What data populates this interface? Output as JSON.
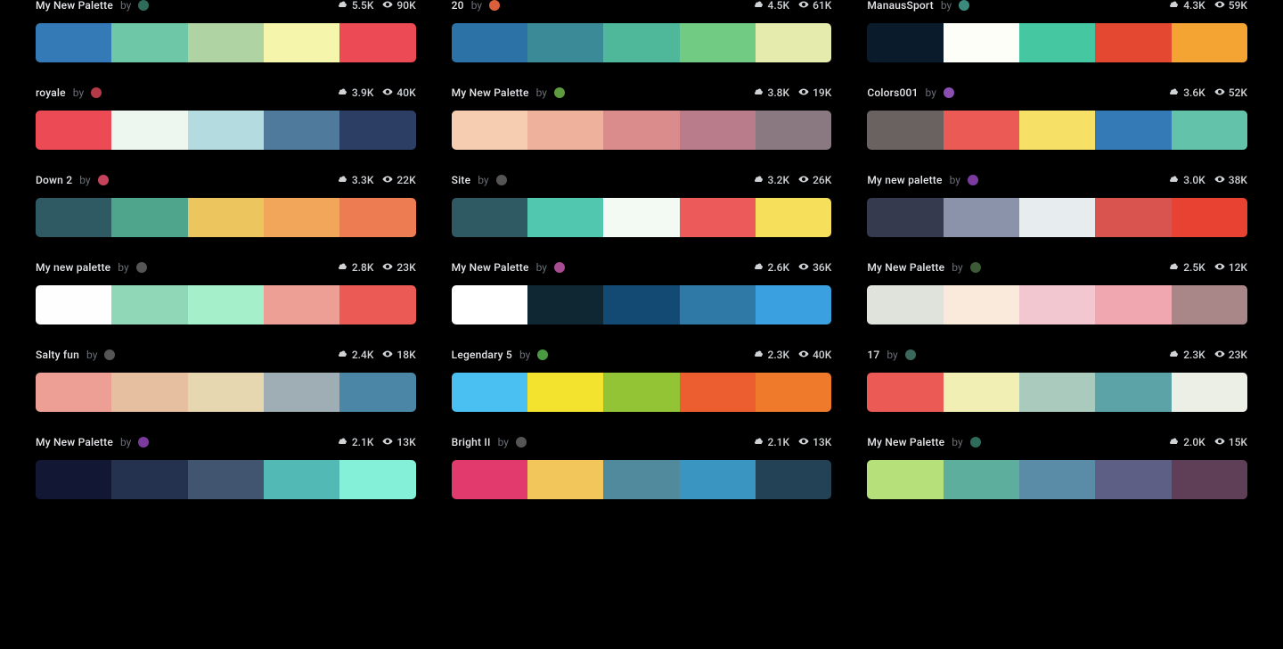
{
  "labels": {
    "by": "by"
  },
  "palettes": [
    {
      "title": "My New Palette",
      "avatar": "#2f6b5a",
      "downloads": "5.5K",
      "views": "90K",
      "colors": [
        "#337ab7",
        "#6ec7a6",
        "#b0d3a3",
        "#f6f5ac",
        "#ec4a55"
      ]
    },
    {
      "title": "20",
      "avatar": "#d9603b",
      "downloads": "4.5K",
      "views": "61K",
      "colors": [
        "#2d72a6",
        "#3b8a98",
        "#4fb79a",
        "#72cb82",
        "#e5ebad"
      ]
    },
    {
      "title": "ManausSport",
      "avatar": "#3c8a7d",
      "downloads": "4.3K",
      "views": "59K",
      "colors": [
        "#0a1b2b",
        "#fcfef7",
        "#45c7a1",
        "#e44830",
        "#f3a432"
      ]
    },
    {
      "title": "royale",
      "avatar": "#b33a46",
      "downloads": "3.9K",
      "views": "40K",
      "colors": [
        "#ec4a55",
        "#edf7ef",
        "#b3dbe0",
        "#507a9c",
        "#2c3e63"
      ]
    },
    {
      "title": "My New Palette",
      "avatar": "#5e9b3e",
      "downloads": "3.8K",
      "views": "19K",
      "colors": [
        "#f6cdb0",
        "#eeb19c",
        "#d98c8b",
        "#b87c8a",
        "#8b7982"
      ]
    },
    {
      "title": "Colors001",
      "avatar": "#8a4fb0",
      "downloads": "3.6K",
      "views": "52K",
      "colors": [
        "#6a6260",
        "#ec5a55",
        "#f6e065",
        "#337ab7",
        "#63c2aa"
      ]
    },
    {
      "title": "Down 2",
      "avatar": "#c4435a",
      "downloads": "3.3K",
      "views": "22K",
      "colors": [
        "#2f5a63",
        "#4ea58c",
        "#ecc55f",
        "#f2a65a",
        "#ed7c53"
      ]
    },
    {
      "title": "Site",
      "avatar": "#555",
      "downloads": "3.2K",
      "views": "26K",
      "colors": [
        "#2f5a63",
        "#51c7b0",
        "#f2faf3",
        "#ec5a5a",
        "#f6df5a"
      ]
    },
    {
      "title": "My new palette",
      "avatar": "#7a3a9e",
      "downloads": "3.0K",
      "views": "38K",
      "colors": [
        "#363a4f",
        "#8b93ab",
        "#e7ecef",
        "#d9534f",
        "#e84332"
      ]
    },
    {
      "title": "My new palette",
      "avatar": "#555",
      "downloads": "2.8K",
      "views": "23K",
      "colors": [
        "#fdfefd",
        "#8fd7b7",
        "#a5f0ca",
        "#ee9f95",
        "#ec5a55"
      ]
    },
    {
      "title": "My New Palette",
      "avatar": "#a74c90",
      "downloads": "2.6K",
      "views": "36K",
      "colors": [
        "#ffffff",
        "#0f2733",
        "#134a73",
        "#2e79a6",
        "#3aa0e0"
      ]
    },
    {
      "title": "My New Palette",
      "avatar": "#3c5a36",
      "downloads": "2.5K",
      "views": "12K",
      "colors": [
        "#e0e3dc",
        "#f9eadb",
        "#f3c7cf",
        "#f0a7b0",
        "#a98788"
      ]
    },
    {
      "title": "Salty fun",
      "avatar": "#555",
      "downloads": "2.4K",
      "views": "18K",
      "colors": [
        "#ee9f95",
        "#e5bfa0",
        "#e7d7b0",
        "#9eaeb4",
        "#4b86a6"
      ]
    },
    {
      "title": "Legendary 5",
      "avatar": "#4a9a42",
      "downloads": "2.3K",
      "views": "40K",
      "colors": [
        "#4abff1",
        "#f3e22e",
        "#93c436",
        "#ec5d2f",
        "#ef7a2c"
      ]
    },
    {
      "title": "17",
      "avatar": "#3c685c",
      "downloads": "2.3K",
      "views": "23K",
      "colors": [
        "#ec5a55",
        "#f2efb5",
        "#a9cabc",
        "#5ba3a6",
        "#ebefe5"
      ]
    },
    {
      "title": "My New Palette",
      "avatar": "#7a3a9e",
      "downloads": "2.1K",
      "views": "13K",
      "colors": [
        "#121734",
        "#25324f",
        "#415570",
        "#52b9b5",
        "#85f0d8"
      ]
    },
    {
      "title": "Bright II",
      "avatar": "#555",
      "downloads": "2.1K",
      "views": "13K",
      "colors": [
        "#e23a6d",
        "#f2c65a",
        "#518a9c",
        "#3a95c1",
        "#234256"
      ]
    },
    {
      "title": "My New Palette",
      "avatar": "#2f6b5a",
      "downloads": "2.0K",
      "views": "15K",
      "colors": [
        "#b5e07a",
        "#5eae9e",
        "#5a8ba7",
        "#5d5f84",
        "#5f3e57"
      ]
    }
  ]
}
